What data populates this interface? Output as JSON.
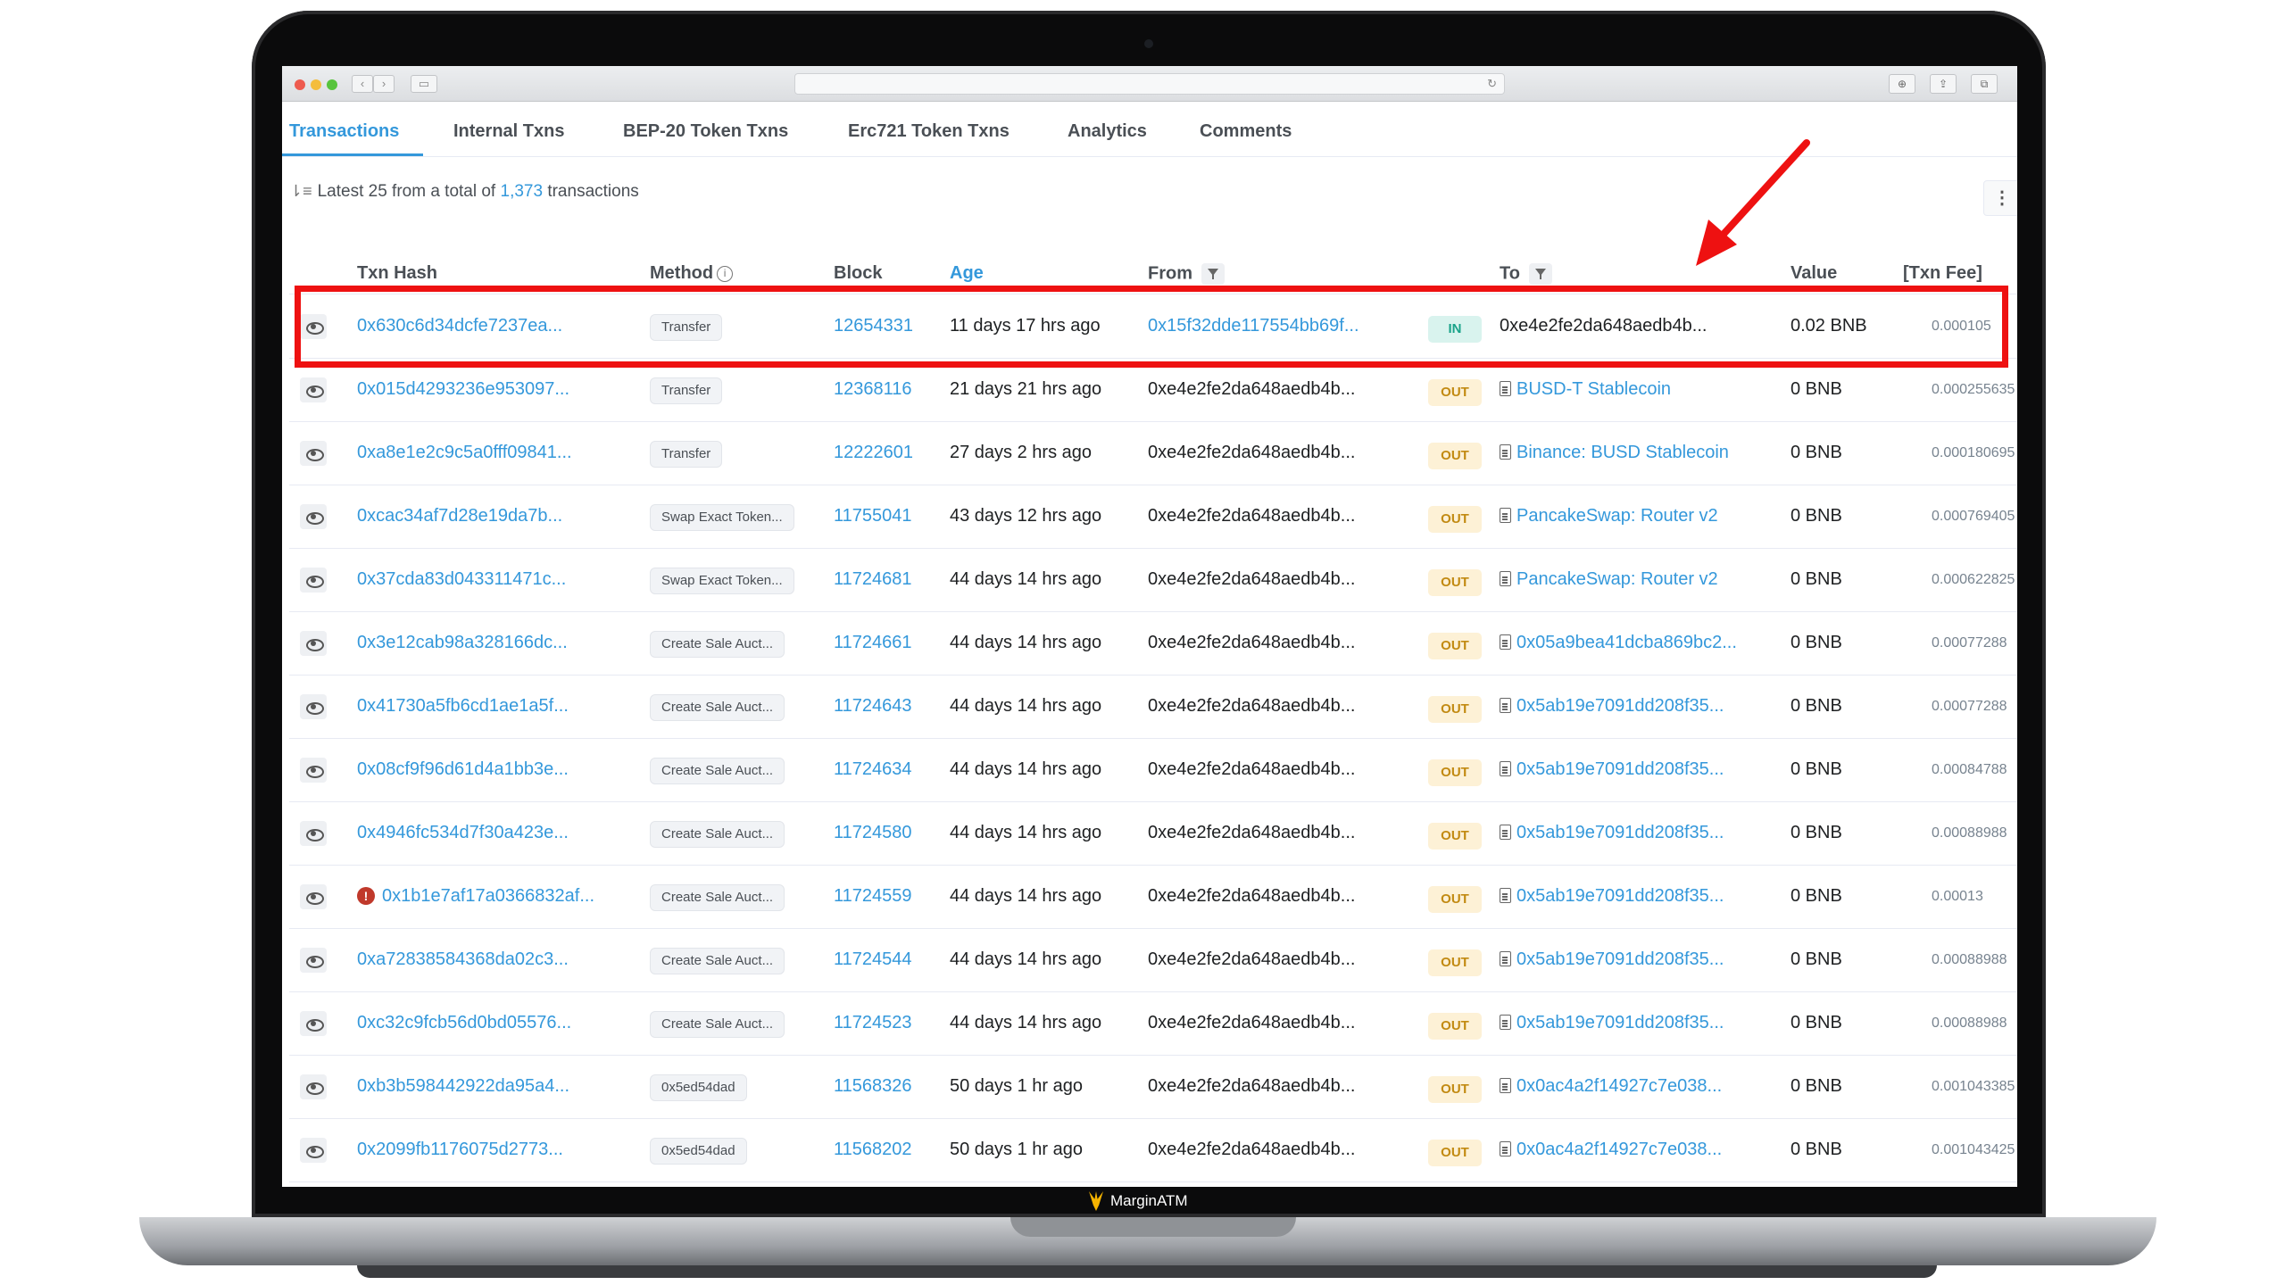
{
  "brand": {
    "name": "MarginATM"
  },
  "tabs": [
    {
      "label": "Transactions",
      "active": true
    },
    {
      "label": "Internal Txns"
    },
    {
      "label": "BEP-20 Token Txns"
    },
    {
      "label": "Erc721 Token Txns"
    },
    {
      "label": "Analytics"
    },
    {
      "label": "Comments"
    }
  ],
  "summary": {
    "prefix": "Latest 25 from a total of",
    "count": "1,373",
    "suffix": "transactions"
  },
  "table": {
    "headers": {
      "txn_hash": "Txn Hash",
      "method": "Method",
      "block": "Block",
      "age": "Age",
      "from": "From",
      "to": "To",
      "value": "Value",
      "fee": "[Txn Fee]"
    },
    "rows": [
      {
        "hash": "0x630c6d34dcfe7237ea...",
        "method": "Transfer",
        "block": "12654331",
        "age": "11 days 17 hrs ago",
        "from": "0x15f32dde117554bb69f...",
        "from_link": true,
        "dir": "IN",
        "to": "0xe4e2fe2da648aedb4b...",
        "to_link": false,
        "to_contract": false,
        "value": "0.02 BNB",
        "fee": "0.000105",
        "error": false
      },
      {
        "hash": "0x015d4293236e953097...",
        "method": "Transfer",
        "block": "12368116",
        "age": "21 days 21 hrs ago",
        "from": "0xe4e2fe2da648aedb4b...",
        "from_link": false,
        "dir": "OUT",
        "to": "BUSD-T Stablecoin",
        "to_link": true,
        "to_contract": true,
        "value": "0 BNB",
        "fee": "0.000255635",
        "error": false
      },
      {
        "hash": "0xa8e1e2c9c5a0fff09841...",
        "method": "Transfer",
        "block": "12222601",
        "age": "27 days 2 hrs ago",
        "from": "0xe4e2fe2da648aedb4b...",
        "from_link": false,
        "dir": "OUT",
        "to": "Binance: BUSD Stablecoin",
        "to_link": true,
        "to_contract": true,
        "value": "0 BNB",
        "fee": "0.000180695",
        "error": false
      },
      {
        "hash": "0xcac34af7d28e19da7b...",
        "method": "Swap Exact Token...",
        "block": "11755041",
        "age": "43 days 12 hrs ago",
        "from": "0xe4e2fe2da648aedb4b...",
        "from_link": false,
        "dir": "OUT",
        "to": "PancakeSwap: Router v2",
        "to_link": true,
        "to_contract": true,
        "value": "0 BNB",
        "fee": "0.000769405",
        "error": false
      },
      {
        "hash": "0x37cda83d043311471c...",
        "method": "Swap Exact Token...",
        "block": "11724681",
        "age": "44 days 14 hrs ago",
        "from": "0xe4e2fe2da648aedb4b...",
        "from_link": false,
        "dir": "OUT",
        "to": "PancakeSwap: Router v2",
        "to_link": true,
        "to_contract": true,
        "value": "0 BNB",
        "fee": "0.000622825",
        "error": false
      },
      {
        "hash": "0x3e12cab98a328166dc...",
        "method": "Create Sale Auct...",
        "block": "11724661",
        "age": "44 days 14 hrs ago",
        "from": "0xe4e2fe2da648aedb4b...",
        "from_link": false,
        "dir": "OUT",
        "to": "0x05a9bea41dcba869bc2...",
        "to_link": true,
        "to_contract": true,
        "value": "0 BNB",
        "fee": "0.00077288",
        "error": false
      },
      {
        "hash": "0x41730a5fb6cd1ae1a5f...",
        "method": "Create Sale Auct...",
        "block": "11724643",
        "age": "44 days 14 hrs ago",
        "from": "0xe4e2fe2da648aedb4b...",
        "from_link": false,
        "dir": "OUT",
        "to": "0x5ab19e7091dd208f35...",
        "to_link": true,
        "to_contract": true,
        "value": "0 BNB",
        "fee": "0.00077288",
        "error": false
      },
      {
        "hash": "0x08cf9f96d61d4a1bb3e...",
        "method": "Create Sale Auct...",
        "block": "11724634",
        "age": "44 days 14 hrs ago",
        "from": "0xe4e2fe2da648aedb4b...",
        "from_link": false,
        "dir": "OUT",
        "to": "0x5ab19e7091dd208f35...",
        "to_link": true,
        "to_contract": true,
        "value": "0 BNB",
        "fee": "0.00084788",
        "error": false
      },
      {
        "hash": "0x4946fc534d7f30a423e...",
        "method": "Create Sale Auct...",
        "block": "11724580",
        "age": "44 days 14 hrs ago",
        "from": "0xe4e2fe2da648aedb4b...",
        "from_link": false,
        "dir": "OUT",
        "to": "0x5ab19e7091dd208f35...",
        "to_link": true,
        "to_contract": true,
        "value": "0 BNB",
        "fee": "0.00088988",
        "error": false
      },
      {
        "hash": "0x1b1e7af17a0366832af...",
        "method": "Create Sale Auct...",
        "block": "11724559",
        "age": "44 days 14 hrs ago",
        "from": "0xe4e2fe2da648aedb4b...",
        "from_link": false,
        "dir": "OUT",
        "to": "0x5ab19e7091dd208f35...",
        "to_link": true,
        "to_contract": true,
        "value": "0 BNB",
        "fee": "0.00013",
        "error": true
      },
      {
        "hash": "0xa72838584368da02c3...",
        "method": "Create Sale Auct...",
        "block": "11724544",
        "age": "44 days 14 hrs ago",
        "from": "0xe4e2fe2da648aedb4b...",
        "from_link": false,
        "dir": "OUT",
        "to": "0x5ab19e7091dd208f35...",
        "to_link": true,
        "to_contract": true,
        "value": "0 BNB",
        "fee": "0.00088988",
        "error": false
      },
      {
        "hash": "0xc32c9fcb56d0bd05576...",
        "method": "Create Sale Auct...",
        "block": "11724523",
        "age": "44 days 14 hrs ago",
        "from": "0xe4e2fe2da648aedb4b...",
        "from_link": false,
        "dir": "OUT",
        "to": "0x5ab19e7091dd208f35...",
        "to_link": true,
        "to_contract": true,
        "value": "0 BNB",
        "fee": "0.00088988",
        "error": false
      },
      {
        "hash": "0xb3b598442922da95a4...",
        "method": "0x5ed54dad",
        "block": "11568326",
        "age": "50 days 1 hr ago",
        "from": "0xe4e2fe2da648aedb4b...",
        "from_link": false,
        "dir": "OUT",
        "to": "0x0ac4a2f14927c7e038...",
        "to_link": true,
        "to_contract": true,
        "value": "0 BNB",
        "fee": "0.001043385",
        "error": false
      },
      {
        "hash": "0x2099fb1176075d2773...",
        "method": "0x5ed54dad",
        "block": "11568202",
        "age": "50 days 1 hr ago",
        "from": "0xe4e2fe2da648aedb4b...",
        "from_link": false,
        "dir": "OUT",
        "to": "0x0ac4a2f14927c7e038...",
        "to_link": true,
        "to_contract": true,
        "value": "0 BNB",
        "fee": "0.001043425",
        "error": false
      }
    ]
  },
  "icons": {
    "eye": "eye-icon",
    "filter": "filter-icon",
    "info": "info-icon",
    "contract": "contract-icon",
    "error": "error-icon"
  },
  "colors": {
    "link": "#3498db",
    "out_badge": "#fdf1d6",
    "in_badge": "#d9f3ee",
    "annotation": "#ee1111"
  }
}
